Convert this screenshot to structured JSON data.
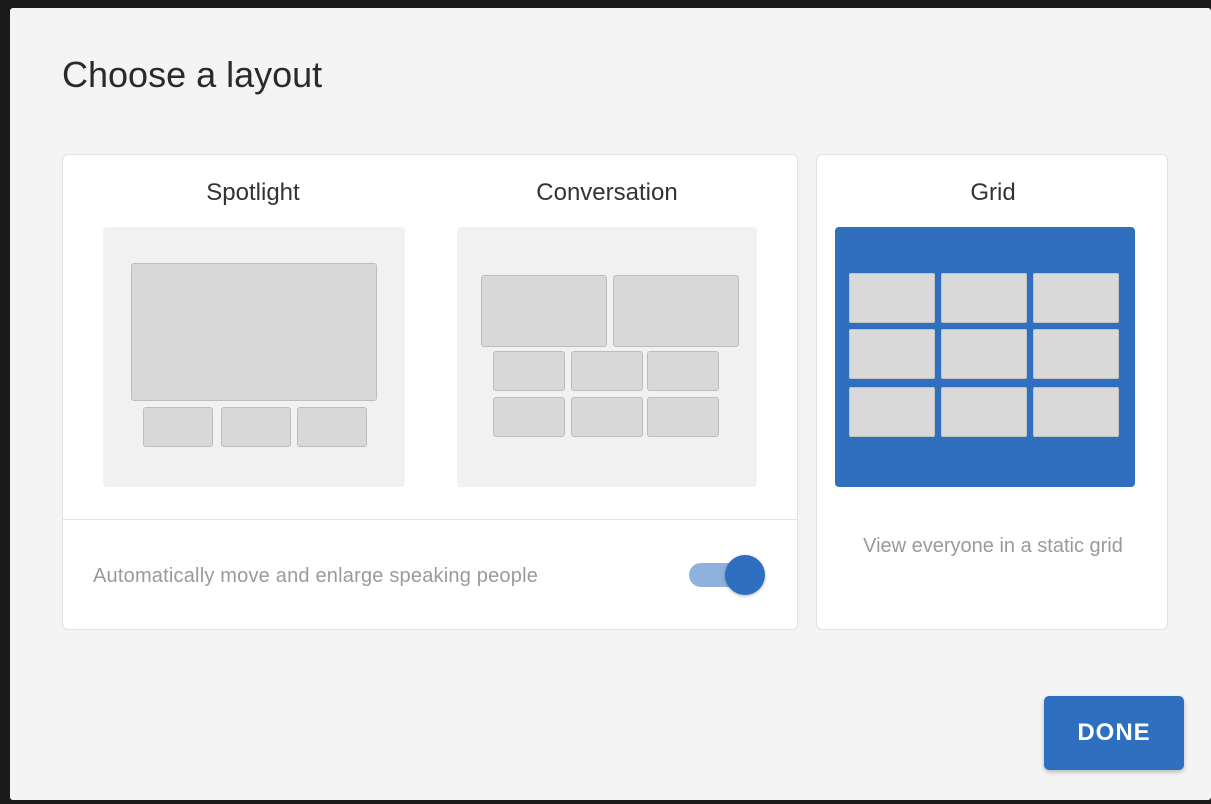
{
  "dialog": {
    "title": "Choose a layout"
  },
  "layouts": {
    "spotlight": {
      "label": "Spotlight"
    },
    "conversation": {
      "label": "Conversation"
    },
    "grid": {
      "label": "Grid",
      "description": "View everyone in a static grid",
      "selected": true
    }
  },
  "auto_speaker": {
    "label": "Automatically move and enlarge speaking people",
    "enabled": true
  },
  "actions": {
    "done_label": "DONE"
  },
  "colors": {
    "accent": "#2e6fbf",
    "toggle_track": "#8fb1de",
    "tile": "#d8d8d8",
    "dialog_bg": "#f4f4f4"
  }
}
